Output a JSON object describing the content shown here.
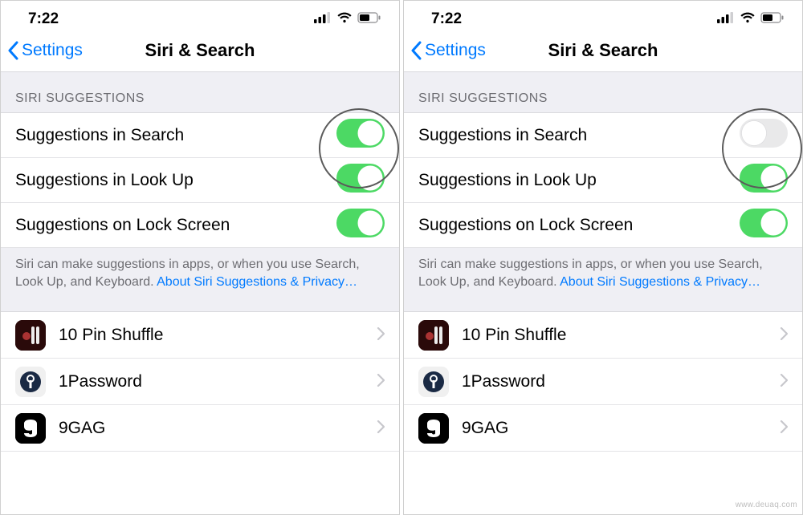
{
  "status": {
    "time": "7:22"
  },
  "nav": {
    "back": "Settings",
    "title": "Siri & Search"
  },
  "section_header": "SIRI SUGGESTIONS",
  "rows": {
    "search": "Suggestions in Search",
    "lookup": "Suggestions in Look Up",
    "lock": "Suggestions on Lock Screen"
  },
  "footer": {
    "text": "Siri can make suggestions in apps, or when you use Search, Look Up, and Keyboard. ",
    "link": "About Siri Suggestions & Privacy…"
  },
  "apps": {
    "a1": "10 Pin Shuffle",
    "a2": "1Password",
    "a3": "9GAG"
  },
  "toggles": {
    "left": {
      "search": true,
      "lookup": true,
      "lock": true
    },
    "right": {
      "search": false,
      "lookup": true,
      "lock": true
    }
  },
  "watermark": "www.deuaq.com"
}
